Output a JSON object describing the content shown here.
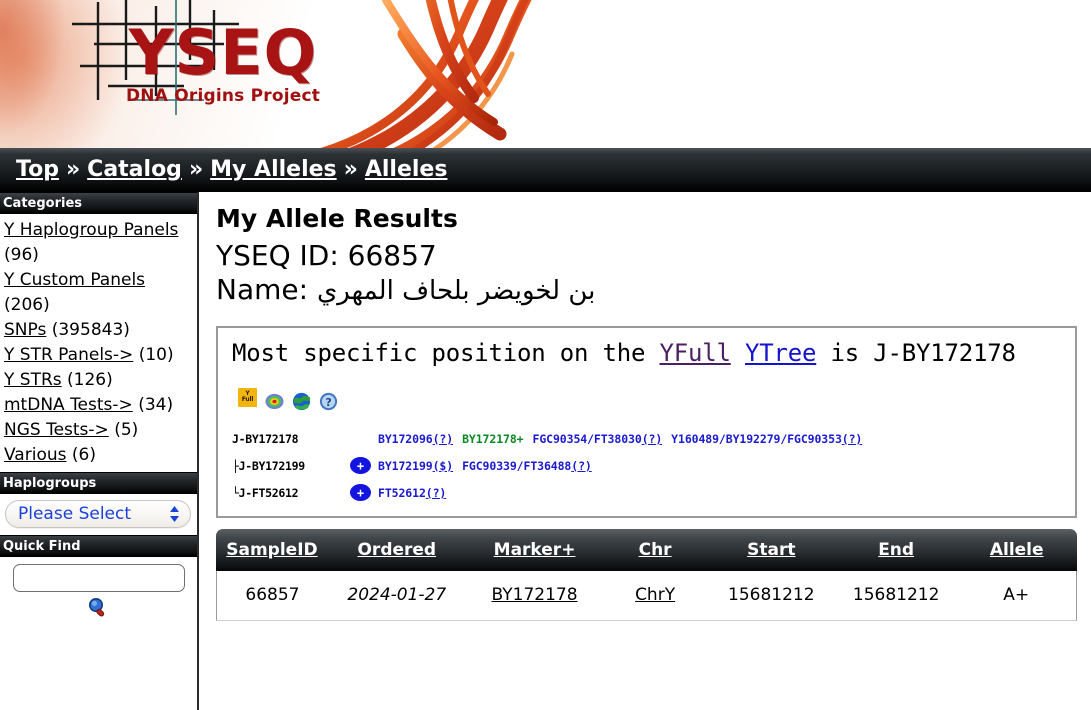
{
  "banner": {
    "logo_main": "YSEQ",
    "logo_sub": "DNA Origins Project"
  },
  "breadcrumb": {
    "separator": "»",
    "items": [
      {
        "label": "Top"
      },
      {
        "label": "Catalog"
      },
      {
        "label": "My Alleles"
      },
      {
        "label": "Alleles"
      }
    ]
  },
  "sidebar": {
    "categories": {
      "title": "Categories",
      "items": [
        {
          "label": "Y Haplogroup Panels",
          "count": "(96)"
        },
        {
          "label": "Y Custom Panels",
          "count": "(206)"
        },
        {
          "label": "SNPs",
          "count": "(395843)"
        },
        {
          "label": "Y STR Panels->",
          "count": "(10)"
        },
        {
          "label": "Y STRs",
          "count": "(126)"
        },
        {
          "label": "mtDNA Tests->",
          "count": "(34)"
        },
        {
          "label": "NGS Tests->",
          "count": "(5)"
        },
        {
          "label": "Various",
          "count": "(6)"
        }
      ]
    },
    "haplogroups": {
      "title": "Haplogroups",
      "select_value": "Please Select"
    },
    "quick_find": {
      "title": "Quick Find",
      "input_value": "",
      "input_placeholder": "",
      "search_icon": "magnifier-icon"
    }
  },
  "main": {
    "page_title": "My Allele Results",
    "yseq_id_label": "YSEQ ID:",
    "yseq_id_value": "66857",
    "name_label": "Name:",
    "name_value": "بن لخويضر بلحاف المهري",
    "yfull_box": {
      "text_part1": "Most specific position on the ",
      "link_yfull": "YFull",
      "link_ytree": "YTree",
      "text_part2": " is J-BY172178",
      "icons": [
        {
          "name": "yfull-logo-icon",
          "top": "Y",
          "bottom": "Full"
        },
        {
          "name": "heatmap-target-icon"
        },
        {
          "name": "globe-icon"
        },
        {
          "name": "help-question-icon"
        }
      ],
      "tree": [
        {
          "prefix": "",
          "haplogroup": "J-BY172178",
          "has_plus": false,
          "snps": [
            {
              "text": "BY172096",
              "suffix": "(?)",
              "color": "blue",
              "suffix_link": true
            },
            {
              "text": "BY172178+",
              "suffix": "",
              "color": "green",
              "suffix_link": false
            },
            {
              "text": "FGC90354/FT38030",
              "suffix": "(?)",
              "color": "blue",
              "suffix_link": true
            },
            {
              "text": "Y160489/BY192279/FGC90353",
              "suffix": "(?)",
              "color": "blue",
              "suffix_link": true
            }
          ]
        },
        {
          "prefix": "├",
          "haplogroup": "J-BY172199",
          "has_plus": true,
          "snps": [
            {
              "text": "BY172199",
              "suffix": "($)",
              "color": "blue",
              "suffix_link": true
            },
            {
              "text": "FGC90339/FT36488",
              "suffix": "(?)",
              "color": "blue",
              "suffix_link": true
            }
          ]
        },
        {
          "prefix": "└",
          "haplogroup": "J-FT52612",
          "has_plus": true,
          "snps": [
            {
              "text": "FT52612",
              "suffix": "(?)",
              "color": "blue",
              "suffix_link": true
            }
          ]
        }
      ]
    },
    "results_table": {
      "columns": [
        "SampleID",
        "Ordered",
        "Marker+",
        "Chr",
        "Start",
        "End",
        "Allele"
      ],
      "rows": [
        {
          "SampleID": "66857",
          "Ordered": "2024-01-27",
          "Marker+": "BY172178",
          "Chr": "ChrY",
          "Start": "15681212",
          "End": "15681212",
          "Allele": "A+"
        }
      ]
    }
  },
  "colors": {
    "brand_red": "#a81414",
    "link_blue": "#1414cc",
    "snp_blue": "#1a1ad0",
    "snp_green": "#0b8a23",
    "yfull_link_purple": "#4b1f63",
    "yfull_icon_yellow": "#f2b50d"
  }
}
